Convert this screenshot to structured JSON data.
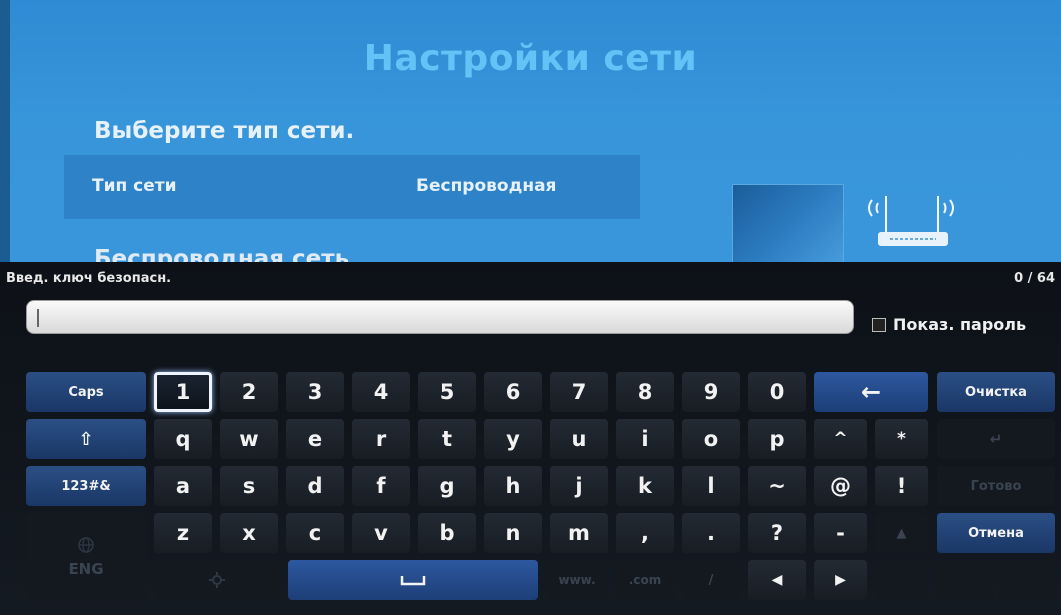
{
  "settings": {
    "title": "Настройки сети",
    "select_type_label": "Выберите тип сети.",
    "network_type_label": "Тип сети",
    "network_type_value": "Беспроводная",
    "wireless_network_label": "Беспроводная сеть"
  },
  "keyboard": {
    "prompt": "Введ. ключ безопасн.",
    "char_count": "0 / 64",
    "input_value": "",
    "show_password_label": "Показ. пароль",
    "left_keys": {
      "caps": "Caps",
      "shift": "⇧",
      "symbols": "123#&",
      "lang_icon": "globe-icon",
      "lang": "ENG"
    },
    "row1": [
      "1",
      "2",
      "3",
      "4",
      "5",
      "6",
      "7",
      "8",
      "9",
      "0"
    ],
    "row2": [
      "q",
      "w",
      "e",
      "r",
      "t",
      "y",
      "u",
      "i",
      "o",
      "p",
      "^",
      "*"
    ],
    "row3": [
      "a",
      "s",
      "d",
      "f",
      "g",
      "h",
      "j",
      "k",
      "l",
      "~",
      "@",
      "!"
    ],
    "row4": [
      "z",
      "x",
      "c",
      "v",
      "b",
      "n",
      "m",
      ",",
      ".",
      "?",
      "-"
    ],
    "row5": {
      "settings_icon": "gear-icon",
      "space_icon": "space-icon",
      "www": "www.",
      "com": ".com",
      "slash": "/",
      "left_arrow": "◀",
      "right_arrow": "▶"
    },
    "backspace": "←",
    "right_keys": {
      "clear": "Очистка",
      "enter": "↵",
      "done": "Готово",
      "up": "▲",
      "cancel": "Отмена"
    }
  },
  "colors": {
    "settings_bg": "#3795da",
    "title": "#62c3f6",
    "keyboard_bg": "#0d1117",
    "func_key": "#2b4f85"
  }
}
